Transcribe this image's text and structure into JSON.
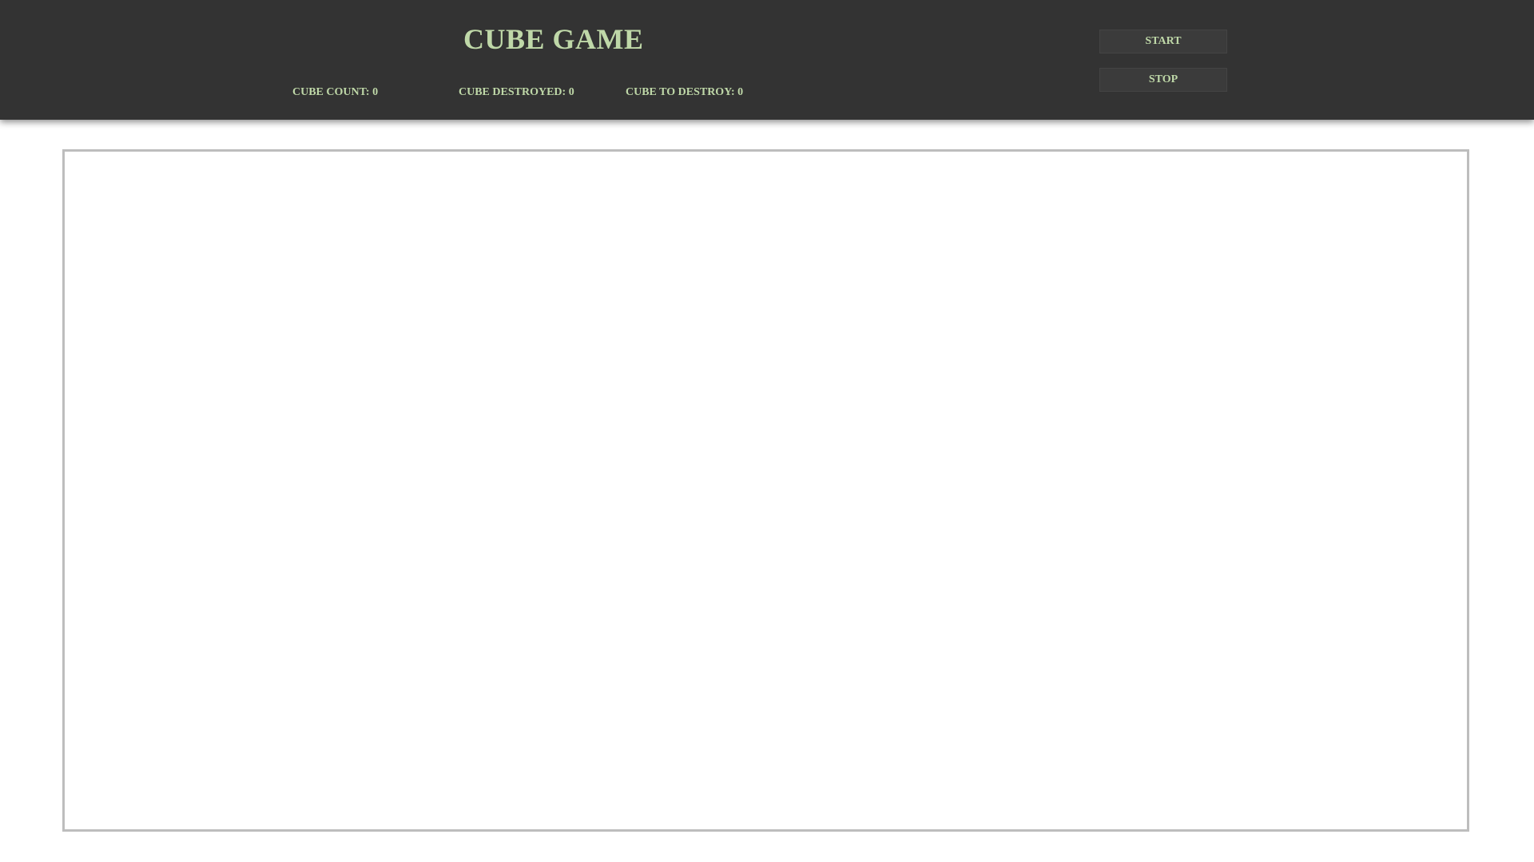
{
  "header": {
    "title": "CUBE GAME",
    "stats": {
      "cube_count": "CUBE COUNT: 0",
      "cube_destroyed": "CUBE DESTROYED: 0",
      "cube_to_destroy": "CUBE TO DESTROY: 0"
    },
    "buttons": {
      "start": "START",
      "stop": "STOP"
    }
  },
  "colors": {
    "header_bg": "#333333",
    "text_accent": "#bfd8a8",
    "game_border": "#bdbdbd"
  }
}
